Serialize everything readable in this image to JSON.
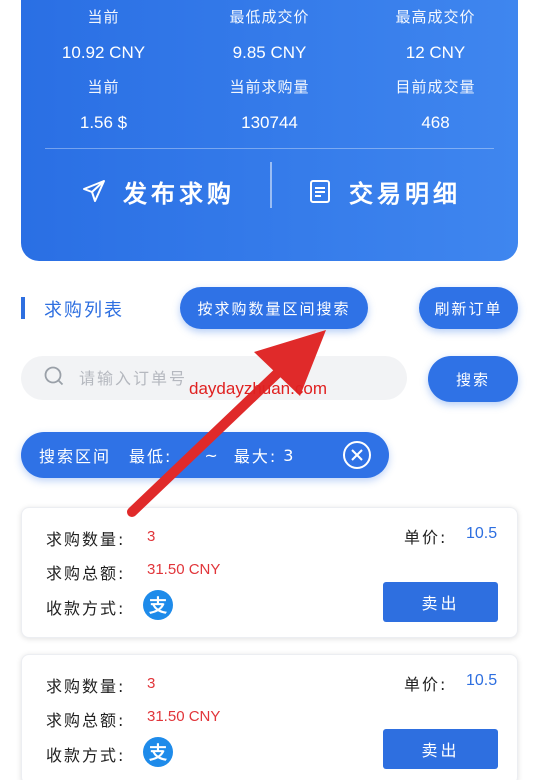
{
  "stats": {
    "row1": [
      {
        "label": "当前",
        "value": "10.92 CNY"
      },
      {
        "label": "最低成交价",
        "value": "9.85 CNY"
      },
      {
        "label": "最高成交价",
        "value": "12 CNY"
      }
    ],
    "row2": [
      {
        "label": "当前",
        "value": "1.56 $"
      },
      {
        "label": "当前求购量",
        "value": "130744"
      },
      {
        "label": "目前成交量",
        "value": "468"
      }
    ]
  },
  "actions": {
    "publish_label": "发布求购",
    "detail_label": "交易明细"
  },
  "section": {
    "title": "求购列表",
    "range_search_label": "按求购数量区间搜索",
    "refresh_label": "刷新订单"
  },
  "search": {
    "placeholder": "请输入订单号",
    "button_label": "搜索"
  },
  "range_chip": {
    "prefix": "搜索区间",
    "min_label": "最低:",
    "min_value": "",
    "separator": "~",
    "max_label": "最大:",
    "max_value": "3"
  },
  "orders": [
    {
      "qty_label": "求购数量:",
      "qty": "3",
      "total_label": "求购总额:",
      "total": "31.50 CNY",
      "pay_label": "收款方式:",
      "pay_icon": "alipay-icon",
      "pay_glyph": "支",
      "price_label": "单价:",
      "price": "10.5",
      "sell_label": "卖出"
    },
    {
      "qty_label": "求购数量:",
      "qty": "3",
      "total_label": "求购总额:",
      "total": "31.50 CNY",
      "pay_label": "收款方式:",
      "pay_icon": "alipay-icon",
      "pay_glyph": "支",
      "price_label": "单价:",
      "price": "10.5",
      "sell_label": "卖出"
    }
  ],
  "watermark": "daydayzhuan.com",
  "colors": {
    "primary": "#2f72e6",
    "price_red": "#e1353a",
    "arrow_red": "#e02a2a",
    "alipay_blue": "#1e8bea"
  }
}
